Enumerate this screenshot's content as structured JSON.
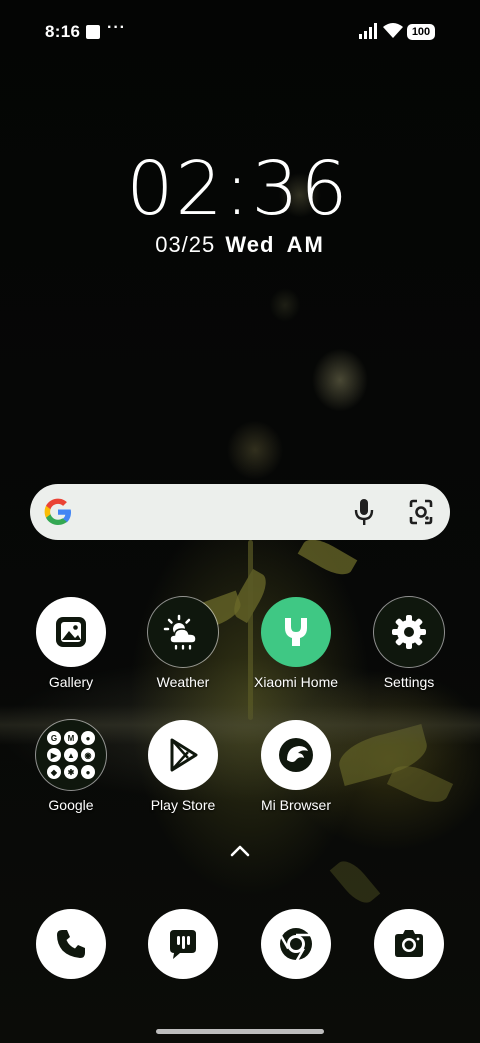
{
  "status_bar": {
    "time": "8:16",
    "more_dots": "···",
    "battery": "100"
  },
  "clock": {
    "time": "02:36",
    "date": "03/25",
    "weekday": "Wed",
    "ampm": "AM"
  },
  "search_bar": {
    "icons": [
      "google-g-icon",
      "mic-icon",
      "google-lens-icon"
    ]
  },
  "apps": [
    {
      "label": "Gallery",
      "icon": "gallery-icon"
    },
    {
      "label": "Weather",
      "icon": "weather-icon"
    },
    {
      "label": "Xiaomi Home",
      "icon": "xiaomi-home-icon"
    },
    {
      "label": "Settings",
      "icon": "gear-icon"
    },
    {
      "label": "Google",
      "icon": "google-folder-icon"
    },
    {
      "label": "Play Store",
      "icon": "play-store-icon"
    },
    {
      "label": "Mi Browser",
      "icon": "mi-browser-icon"
    }
  ],
  "dock": [
    {
      "icon": "phone-icon"
    },
    {
      "icon": "messages-icon"
    },
    {
      "icon": "chrome-icon"
    },
    {
      "icon": "camera-icon"
    }
  ],
  "colors": {
    "search_bg": "#ecefec",
    "icon_dark": "#0f170d",
    "xiaomi_green": "#3fc884"
  }
}
